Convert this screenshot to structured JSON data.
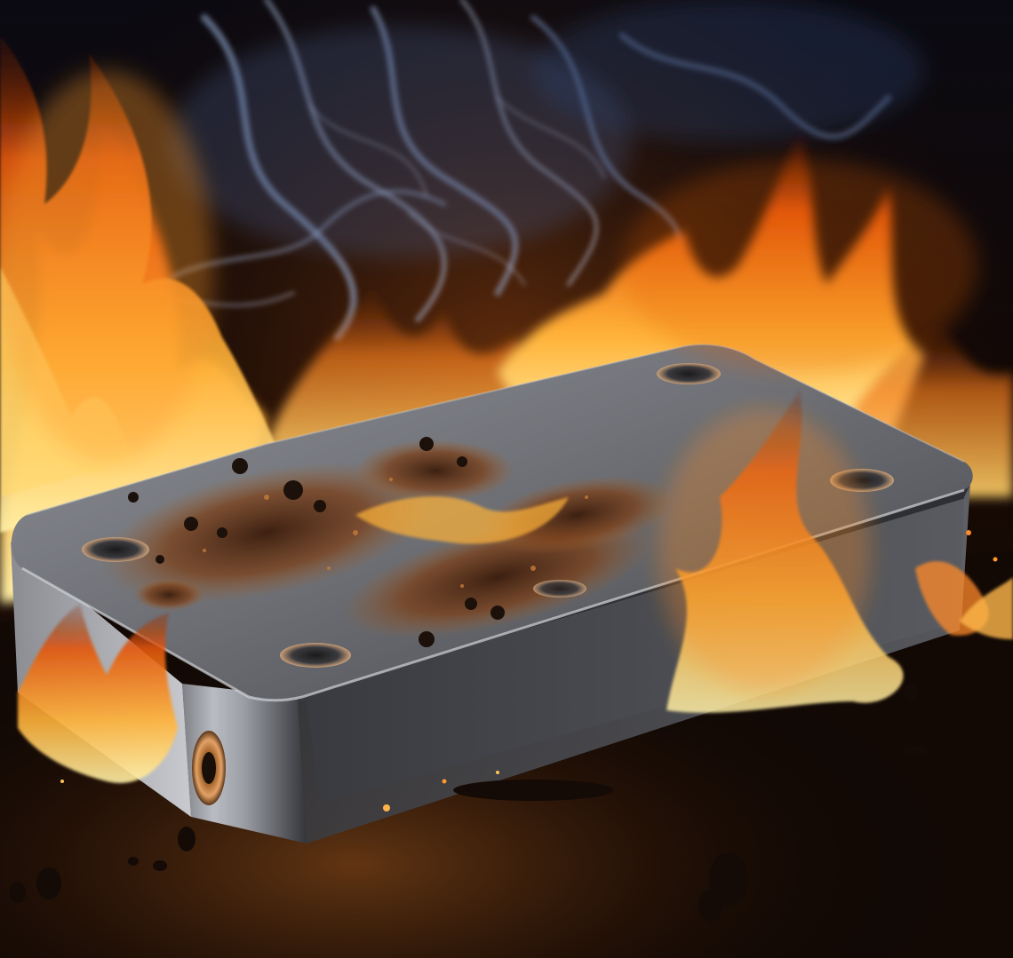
{
  "scene": {
    "subject": "battery-on-fire",
    "elements": [
      "smoke",
      "flames",
      "metal-battery-casing",
      "scorch-residue",
      "screw-holes",
      "terminal",
      "embers",
      "dark-surface"
    ]
  },
  "palette": {
    "flame_core": "#fff1a8",
    "flame_mid": "#ffb238",
    "flame_outer": "#e3560c",
    "smoke": "#9db6e0",
    "metal_light": "#b9bcc2",
    "metal_dark": "#3e4046",
    "scorch": "#5a2d12",
    "background": "#050302"
  }
}
